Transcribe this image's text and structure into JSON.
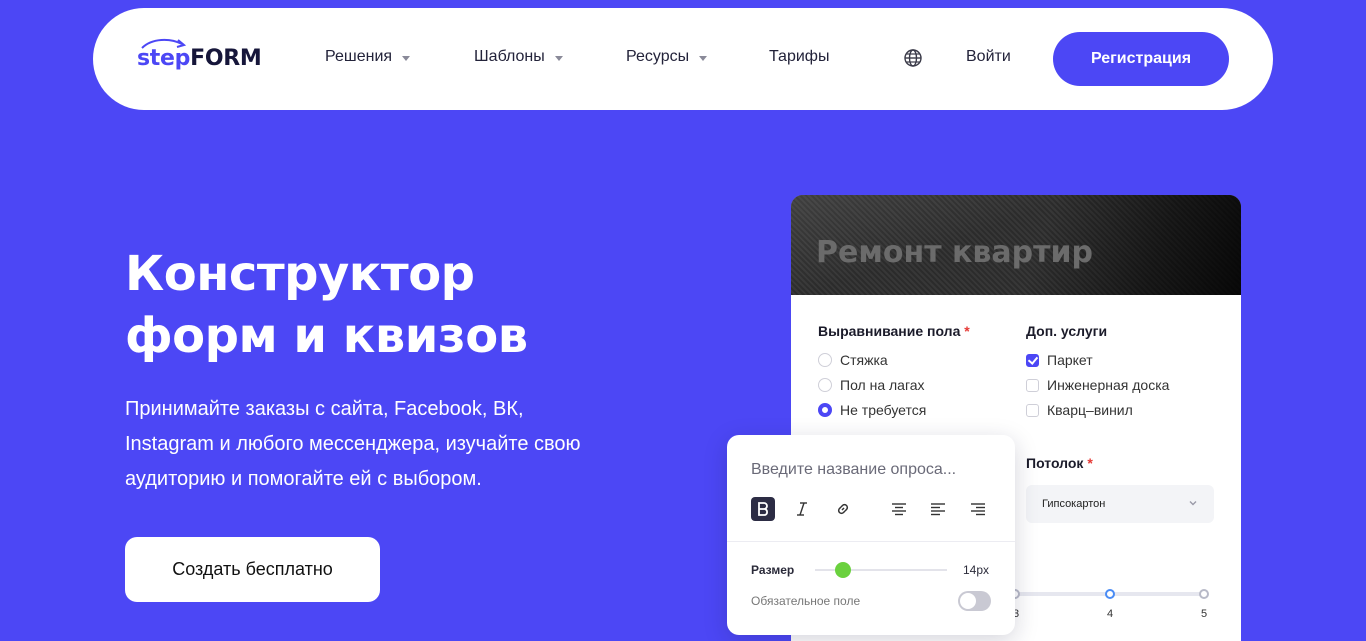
{
  "nav": {
    "logo_step": "step",
    "logo_form": "FORM",
    "items": [
      {
        "label": "Решения",
        "has_dropdown": true
      },
      {
        "label": "Шаблоны",
        "has_dropdown": true
      },
      {
        "label": "Ресурсы",
        "has_dropdown": true
      },
      {
        "label": "Тарифы",
        "has_dropdown": false
      }
    ],
    "language_icon": "globe-icon",
    "login_label": "Войти",
    "register_label": "Регистрация"
  },
  "hero": {
    "title_line1": "Конструктор",
    "title_line2": "форм и квизов",
    "subtitle_line1": "Принимайте заказы с сайта, Facebook, ВК,",
    "subtitle_line2": "Instagram и любого мессенджера, изучайте свою",
    "subtitle_line3": "аудиторию и помогайте ей с выбором.",
    "cta_label": "Создать бесплатно"
  },
  "form_preview": {
    "header_title": "Ремонт квартир",
    "floor": {
      "title": "Выравнивание пола",
      "required_mark": "*",
      "options": [
        {
          "label": "Стяжка",
          "selected": false
        },
        {
          "label": "Пол на лагах",
          "selected": false
        },
        {
          "label": "Не требуется",
          "selected": true
        }
      ]
    },
    "extras": {
      "title": "Доп. услуги",
      "options": [
        {
          "label": "Паркет",
          "checked": true
        },
        {
          "label": "Инженерная доска",
          "checked": false
        },
        {
          "label": "Кварц–винил",
          "checked": false
        }
      ]
    },
    "ceiling": {
      "title": "Потолок",
      "required_mark": "*",
      "selected": "Гипсокартон"
    },
    "scale": {
      "labels": [
        "3",
        "4",
        "5"
      ]
    }
  },
  "editor": {
    "placeholder": "Введите название опроса...",
    "toolbar": [
      "bold-icon",
      "italic-icon",
      "link-icon",
      "align-center-icon",
      "align-left-icon",
      "align-right-icon"
    ],
    "size_label": "Размер",
    "size_value": "14px",
    "required_label": "Обязательное поле",
    "required_on": false
  },
  "colors": {
    "brand": "#4c47f5",
    "slider_green": "#6ad13e",
    "required_red": "#e53935"
  }
}
